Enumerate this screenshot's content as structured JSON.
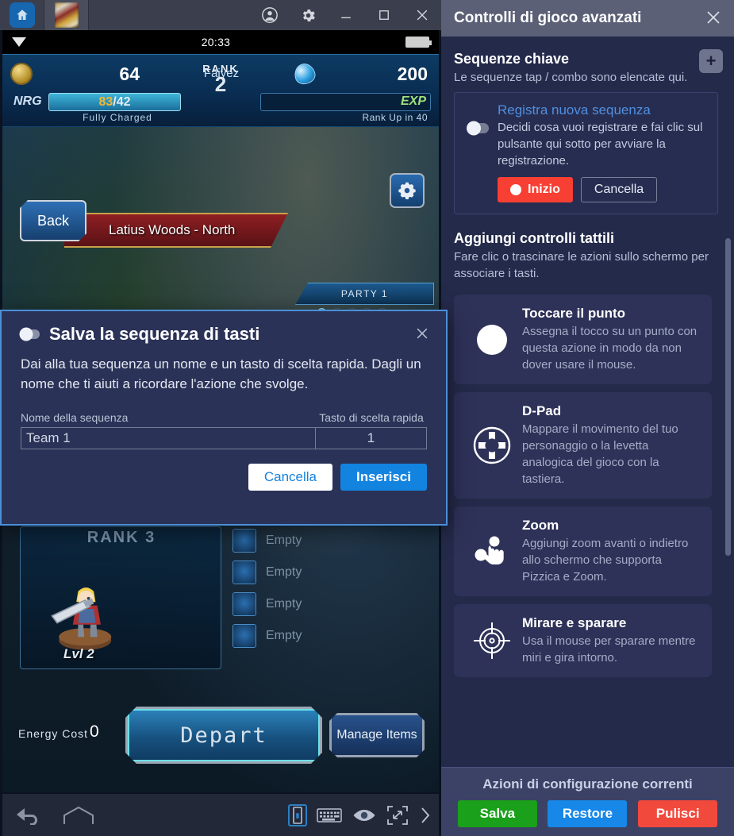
{
  "window": {
    "tabs": [
      {
        "name": "home-tab",
        "icon": "home-icon",
        "active": false
      },
      {
        "name": "game-tab",
        "icon": "game-thumbnail-icon",
        "active": true
      }
    ],
    "controls": [
      {
        "name": "account-button",
        "icon": "account-circle-icon",
        "glyph": "account"
      },
      {
        "name": "settings-button",
        "icon": "gear-icon",
        "glyph": "gear"
      },
      {
        "name": "minimize-button",
        "icon": "minimize-icon",
        "glyph": "minimize"
      },
      {
        "name": "maximize-button",
        "icon": "maximize-icon",
        "glyph": "maximize"
      },
      {
        "name": "close-button",
        "icon": "close-icon",
        "glyph": "close"
      }
    ]
  },
  "android": {
    "statusbar": {
      "wifi_icon": "wifi-icon",
      "clock": "20:33",
      "battery_icon": "battery-full-icon"
    },
    "hud": {
      "coin_icon": "coin-icon",
      "coin_value": "64",
      "player_name": "Fajyez",
      "gem_icon": "gem-icon",
      "gem_value": "200",
      "rank_label": "RANK",
      "rank_value": "2",
      "nrg_label": "NRG",
      "nrg_current": "83",
      "nrg_sep": "/",
      "nrg_max": "42",
      "nrg_status": "Fully Charged",
      "exp_label": "EXP",
      "exp_status": "Rank Up in 40"
    },
    "scene": {
      "back_button": "Back",
      "location": "Latius Woods - North",
      "settings_icon": "cog-icon",
      "party_tab": "PARTY 1",
      "party_dots": 5,
      "party_active_dot": 0
    },
    "party": {
      "rank_label": "RANK 3",
      "character_level": "Lvl 2",
      "slots": [
        "Empty",
        "Empty",
        "Empty",
        "Empty"
      ]
    },
    "depart": {
      "energy_cost_label": "Energy Cost",
      "energy_cost_value": "0",
      "depart_label": "Depart",
      "manage_items_label": "Manage Items"
    },
    "navbar": {
      "back_icon": "back-arrow-icon",
      "home_icon": "home-pentagon-icon",
      "right_icons": [
        {
          "name": "volume-icon",
          "icon": "volume-slider-icon",
          "selected": true
        },
        {
          "name": "keyboard-icon",
          "icon": "keyboard-icon",
          "selected": false
        },
        {
          "name": "eye-icon",
          "icon": "eye-icon",
          "selected": false
        },
        {
          "name": "fullscreen-icon",
          "icon": "fullscreen-expand-icon",
          "selected": false
        },
        {
          "name": "more-icon",
          "icon": "chevron-right-icon",
          "selected": false
        }
      ]
    }
  },
  "modal": {
    "toggle_icon": "toggle-switch-icon",
    "title": "Salva la sequenza di tasti",
    "close_icon": "close-icon",
    "body": "Dai alla tua sequenza un nome e un tasto di scelta rapida. Dagli un nome che ti aiuti a ricordare l'azione che svolge.",
    "name_label": "Nome della sequenza",
    "key_label": "Tasto di scelta rapida",
    "name_value": "Team 1",
    "name_placeholder": "Team 1",
    "key_value": "1",
    "cancel_label": "Cancella",
    "confirm_label": "Inserisci"
  },
  "panel": {
    "title": "Controlli di gioco avanzati",
    "close_icon": "close-icon",
    "key_sequences": {
      "title": "Sequenze chiave",
      "subtitle": "Le sequenze tap / combo sono elencate qui.",
      "add_icon": "plus-icon",
      "add_label": "+",
      "record": {
        "toggle_icon": "toggle-switch-icon",
        "title": "Registra nuova sequenza",
        "description": "Decidi cosa vuoi registrare e fai clic sul pulsante qui sotto per avviare la registrazione.",
        "start_label": "Inizio",
        "start_icon": "record-dot-icon",
        "cancel_label": "Cancella"
      }
    },
    "touch_controls": {
      "title": "Aggiungi controlli tattili",
      "subtitle": "Fare clic o trascinare le azioni sullo schermo per associare i tasti.",
      "cards": [
        {
          "icon": "tap-circle-icon",
          "title": "Toccare il punto",
          "description": "Assegna il tocco su un punto con questa azione in modo da non dover usare il mouse."
        },
        {
          "icon": "dpad-icon",
          "title": "D-Pad",
          "description": "Mappare il movimento del tuo personaggio o la levetta analogica del gioco con la tastiera."
        },
        {
          "icon": "pinch-zoom-icon",
          "title": "Zoom",
          "description": "Aggiungi zoom avanti o indietro allo schermo che supporta Pizzica e Zoom."
        },
        {
          "icon": "aim-crosshair-icon",
          "title": "Mirare e sparare",
          "description": "Usa il mouse per sparare mentre miri e gira intorno."
        }
      ]
    },
    "footer": {
      "title": "Azioni di configurazione correnti",
      "save_label": "Salva",
      "restore_label": "Restore",
      "clear_label": "Pulisci"
    },
    "scrollbar": "vertical-scrollbar"
  },
  "colors": {
    "panel_bg": "#242a4a",
    "panel_header": "#5b6076",
    "accent_blue": "#1383e0",
    "record_red": "#f73f33",
    "save_green": "#1aa01a",
    "clear_red": "#f2493d"
  }
}
